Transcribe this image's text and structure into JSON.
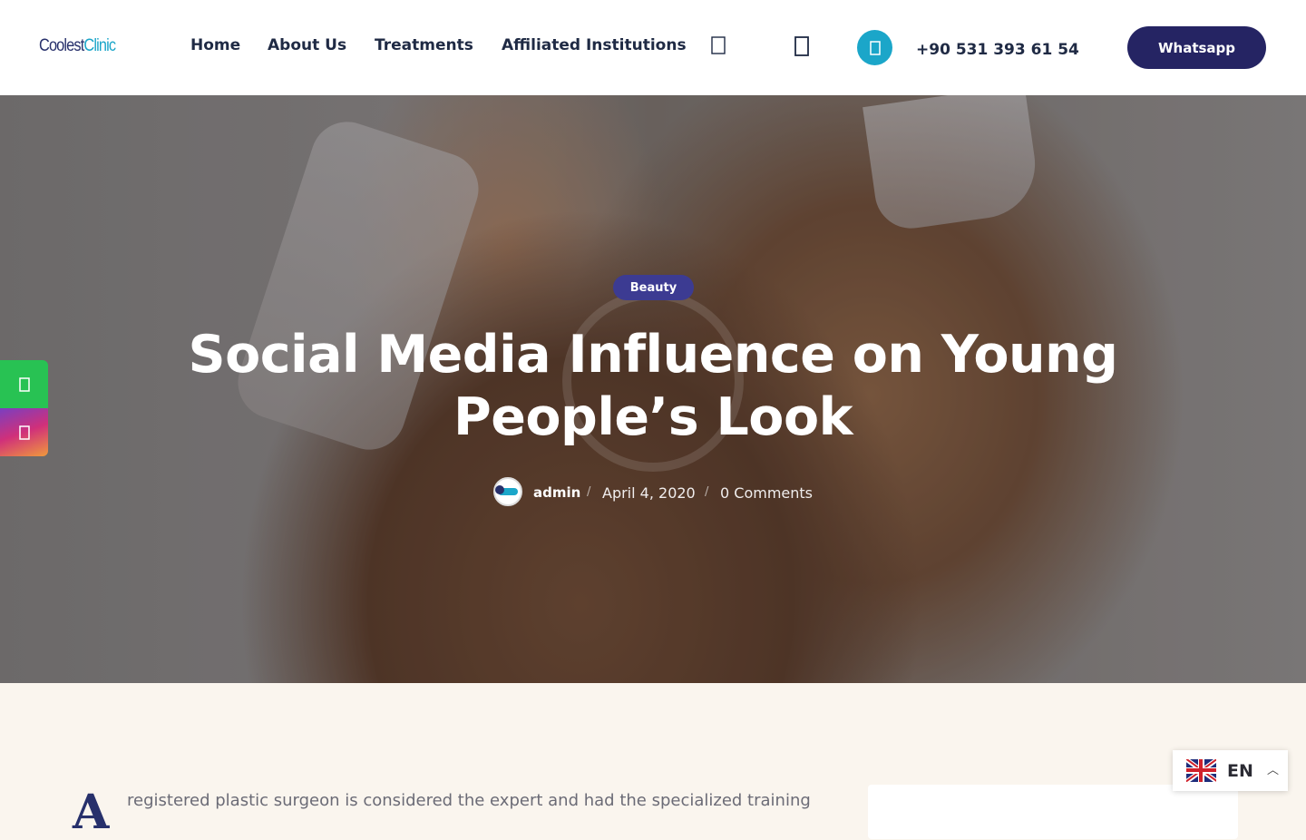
{
  "header": {
    "logo": {
      "part1": "Coolest",
      "part2": "Clinic"
    },
    "nav": [
      {
        "label": "Home"
      },
      {
        "label": "About Us"
      },
      {
        "label": "Treatments"
      },
      {
        "label": "Affiliated Institutions"
      }
    ],
    "icons": {
      "search": "search-icon",
      "account": "user-icon",
      "phone": "phone-icon"
    },
    "phone_number": "+90 531 393 61 54",
    "whatsapp_button": "Whatsapp",
    "accent_color": "#1ba6c9",
    "brand_color": "#252463"
  },
  "hero": {
    "category": "Beauty",
    "title": "Social Media Influence on Young People’s Look",
    "author": "admin",
    "date": "April 4, 2020",
    "comments": "0 Comments",
    "separator": "/"
  },
  "side_social": [
    {
      "name": "whatsapp-icon",
      "color": "#28c253"
    },
    {
      "name": "instagram-icon",
      "color": "#d0307a"
    }
  ],
  "article": {
    "drop_cap": "A",
    "first_line": "registered plastic surgeon is considered the expert and had the specialized training"
  },
  "language": {
    "code": "EN",
    "flag": "uk-flag"
  }
}
